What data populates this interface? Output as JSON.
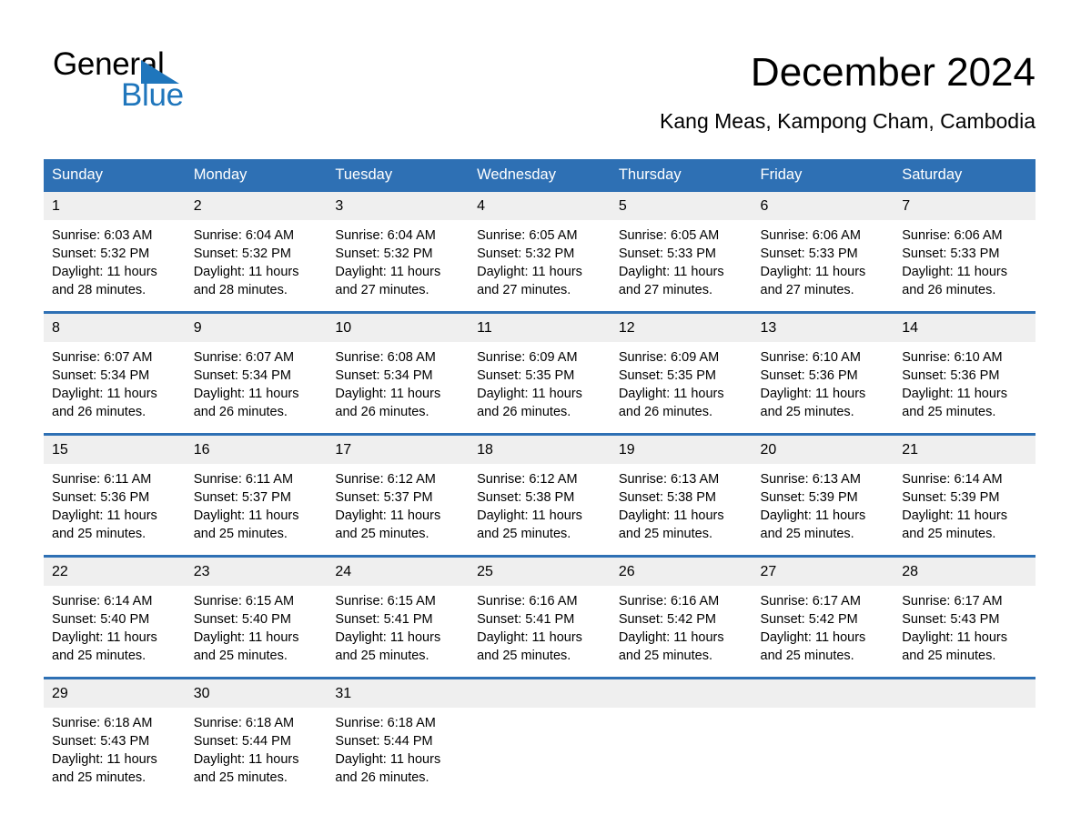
{
  "logo": {
    "word_top": "General",
    "word_bottom": "Blue",
    "triangle_color": "#1f76bc"
  },
  "header": {
    "title": "December 2024",
    "location": "Kang Meas, Kampong Cham, Cambodia"
  },
  "theme": {
    "header_blue": "#2e70b4",
    "daynum_band": "#efefef",
    "page_background": "#ffffff",
    "text": "#000000"
  },
  "calendar": {
    "weekday_headers": [
      "Sunday",
      "Monday",
      "Tuesday",
      "Wednesday",
      "Thursday",
      "Friday",
      "Saturday"
    ],
    "weeks": [
      [
        {
          "day": "1",
          "sunrise": "Sunrise: 6:03 AM",
          "sunset": "Sunset: 5:32 PM",
          "daylight": "Daylight: 11 hours and 28 minutes."
        },
        {
          "day": "2",
          "sunrise": "Sunrise: 6:04 AM",
          "sunset": "Sunset: 5:32 PM",
          "daylight": "Daylight: 11 hours and 28 minutes."
        },
        {
          "day": "3",
          "sunrise": "Sunrise: 6:04 AM",
          "sunset": "Sunset: 5:32 PM",
          "daylight": "Daylight: 11 hours and 27 minutes."
        },
        {
          "day": "4",
          "sunrise": "Sunrise: 6:05 AM",
          "sunset": "Sunset: 5:32 PM",
          "daylight": "Daylight: 11 hours and 27 minutes."
        },
        {
          "day": "5",
          "sunrise": "Sunrise: 6:05 AM",
          "sunset": "Sunset: 5:33 PM",
          "daylight": "Daylight: 11 hours and 27 minutes."
        },
        {
          "day": "6",
          "sunrise": "Sunrise: 6:06 AM",
          "sunset": "Sunset: 5:33 PM",
          "daylight": "Daylight: 11 hours and 27 minutes."
        },
        {
          "day": "7",
          "sunrise": "Sunrise: 6:06 AM",
          "sunset": "Sunset: 5:33 PM",
          "daylight": "Daylight: 11 hours and 26 minutes."
        }
      ],
      [
        {
          "day": "8",
          "sunrise": "Sunrise: 6:07 AM",
          "sunset": "Sunset: 5:34 PM",
          "daylight": "Daylight: 11 hours and 26 minutes."
        },
        {
          "day": "9",
          "sunrise": "Sunrise: 6:07 AM",
          "sunset": "Sunset: 5:34 PM",
          "daylight": "Daylight: 11 hours and 26 minutes."
        },
        {
          "day": "10",
          "sunrise": "Sunrise: 6:08 AM",
          "sunset": "Sunset: 5:34 PM",
          "daylight": "Daylight: 11 hours and 26 minutes."
        },
        {
          "day": "11",
          "sunrise": "Sunrise: 6:09 AM",
          "sunset": "Sunset: 5:35 PM",
          "daylight": "Daylight: 11 hours and 26 minutes."
        },
        {
          "day": "12",
          "sunrise": "Sunrise: 6:09 AM",
          "sunset": "Sunset: 5:35 PM",
          "daylight": "Daylight: 11 hours and 26 minutes."
        },
        {
          "day": "13",
          "sunrise": "Sunrise: 6:10 AM",
          "sunset": "Sunset: 5:36 PM",
          "daylight": "Daylight: 11 hours and 25 minutes."
        },
        {
          "day": "14",
          "sunrise": "Sunrise: 6:10 AM",
          "sunset": "Sunset: 5:36 PM",
          "daylight": "Daylight: 11 hours and 25 minutes."
        }
      ],
      [
        {
          "day": "15",
          "sunrise": "Sunrise: 6:11 AM",
          "sunset": "Sunset: 5:36 PM",
          "daylight": "Daylight: 11 hours and 25 minutes."
        },
        {
          "day": "16",
          "sunrise": "Sunrise: 6:11 AM",
          "sunset": "Sunset: 5:37 PM",
          "daylight": "Daylight: 11 hours and 25 minutes."
        },
        {
          "day": "17",
          "sunrise": "Sunrise: 6:12 AM",
          "sunset": "Sunset: 5:37 PM",
          "daylight": "Daylight: 11 hours and 25 minutes."
        },
        {
          "day": "18",
          "sunrise": "Sunrise: 6:12 AM",
          "sunset": "Sunset: 5:38 PM",
          "daylight": "Daylight: 11 hours and 25 minutes."
        },
        {
          "day": "19",
          "sunrise": "Sunrise: 6:13 AM",
          "sunset": "Sunset: 5:38 PM",
          "daylight": "Daylight: 11 hours and 25 minutes."
        },
        {
          "day": "20",
          "sunrise": "Sunrise: 6:13 AM",
          "sunset": "Sunset: 5:39 PM",
          "daylight": "Daylight: 11 hours and 25 minutes."
        },
        {
          "day": "21",
          "sunrise": "Sunrise: 6:14 AM",
          "sunset": "Sunset: 5:39 PM",
          "daylight": "Daylight: 11 hours and 25 minutes."
        }
      ],
      [
        {
          "day": "22",
          "sunrise": "Sunrise: 6:14 AM",
          "sunset": "Sunset: 5:40 PM",
          "daylight": "Daylight: 11 hours and 25 minutes."
        },
        {
          "day": "23",
          "sunrise": "Sunrise: 6:15 AM",
          "sunset": "Sunset: 5:40 PM",
          "daylight": "Daylight: 11 hours and 25 minutes."
        },
        {
          "day": "24",
          "sunrise": "Sunrise: 6:15 AM",
          "sunset": "Sunset: 5:41 PM",
          "daylight": "Daylight: 11 hours and 25 minutes."
        },
        {
          "day": "25",
          "sunrise": "Sunrise: 6:16 AM",
          "sunset": "Sunset: 5:41 PM",
          "daylight": "Daylight: 11 hours and 25 minutes."
        },
        {
          "day": "26",
          "sunrise": "Sunrise: 6:16 AM",
          "sunset": "Sunset: 5:42 PM",
          "daylight": "Daylight: 11 hours and 25 minutes."
        },
        {
          "day": "27",
          "sunrise": "Sunrise: 6:17 AM",
          "sunset": "Sunset: 5:42 PM",
          "daylight": "Daylight: 11 hours and 25 minutes."
        },
        {
          "day": "28",
          "sunrise": "Sunrise: 6:17 AM",
          "sunset": "Sunset: 5:43 PM",
          "daylight": "Daylight: 11 hours and 25 minutes."
        }
      ],
      [
        {
          "day": "29",
          "sunrise": "Sunrise: 6:18 AM",
          "sunset": "Sunset: 5:43 PM",
          "daylight": "Daylight: 11 hours and 25 minutes."
        },
        {
          "day": "30",
          "sunrise": "Sunrise: 6:18 AM",
          "sunset": "Sunset: 5:44 PM",
          "daylight": "Daylight: 11 hours and 25 minutes."
        },
        {
          "day": "31",
          "sunrise": "Sunrise: 6:18 AM",
          "sunset": "Sunset: 5:44 PM",
          "daylight": "Daylight: 11 hours and 26 minutes."
        },
        {
          "day": "",
          "sunrise": "",
          "sunset": "",
          "daylight": ""
        },
        {
          "day": "",
          "sunrise": "",
          "sunset": "",
          "daylight": ""
        },
        {
          "day": "",
          "sunrise": "",
          "sunset": "",
          "daylight": ""
        },
        {
          "day": "",
          "sunrise": "",
          "sunset": "",
          "daylight": ""
        }
      ]
    ]
  }
}
